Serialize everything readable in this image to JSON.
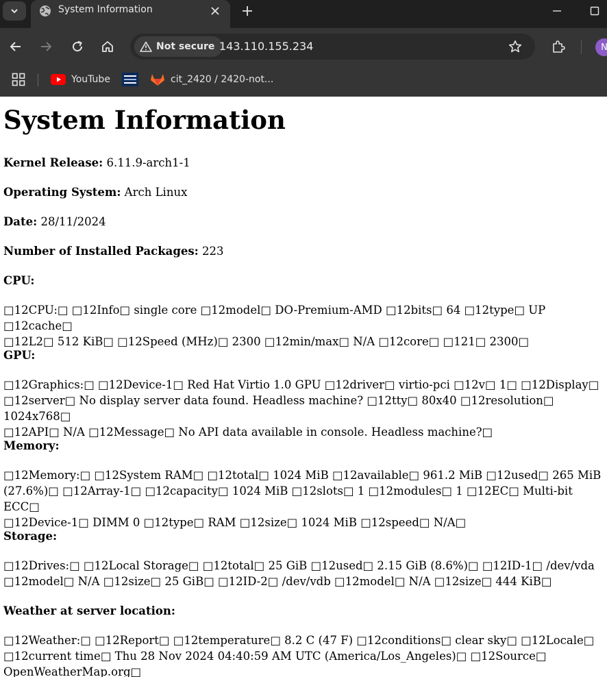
{
  "browser": {
    "tab_title": "System Information",
    "security_label": "Not secure",
    "url": "143.110.155.234",
    "avatar_letter": "N",
    "bookmarks": [
      {
        "label": "YouTube"
      },
      {
        "label": "cit_2420 / 2420-not..."
      }
    ]
  },
  "page": {
    "title": "System Information",
    "kernel": {
      "label": "Kernel Release:",
      "value": "6.11.9-arch1-1"
    },
    "os": {
      "label": "Operating System:",
      "value": "Arch Linux"
    },
    "date": {
      "label": "Date:",
      "value": "28/11/2024"
    },
    "packages": {
      "label": "Number of Installed Packages:",
      "value": "223"
    },
    "cpu": {
      "label": "CPU:",
      "text": "□12CPU:□ □12Info□ single core □12model□ DO-Premium-AMD □12bits□ 64 □12type□ UP □12cache□\n□12L2□ 512 KiB□ □12Speed (MHz)□ 2300 □12min/max□ N/A □12core□ □121□ 2300□"
    },
    "gpu": {
      "label": "GPU:",
      "text": "□12Graphics:□ □12Device-1□ Red Hat Virtio 1.0 GPU □12driver□ virtio-pci □12v□ 1□ □12Display□\n□12server□ No display server data found. Headless machine? □12tty□ 80x40 □12resolution□ 1024x768□\n□12API□ N/A □12Message□ No API data available in console. Headless machine?□"
    },
    "memory": {
      "label": "Memory:",
      "text": "□12Memory:□ □12System RAM□ □12total□ 1024 MiB □12available□ 961.2 MiB □12used□ 265 MiB\n(27.6%)□ □12Array-1□ □12capacity□ 1024 MiB □12slots□ 1 □12modules□ 1 □12EC□ Multi-bit ECC□\n□12Device-1□ DIMM 0 □12type□ RAM □12size□ 1024 MiB □12speed□ N/A□"
    },
    "storage": {
      "label": "Storage:",
      "text": "□12Drives:□ □12Local Storage□ □12total□ 25 GiB □12used□ 2.15 GiB (8.6%)□ □12ID-1□ /dev/vda\n□12model□ N/A □12size□ 25 GiB□ □12ID-2□ /dev/vdb □12model□ N/A □12size□ 444 KiB□"
    },
    "weather": {
      "label": "Weather at server location:",
      "text": "□12Weather:□ □12Report□ □12temperature□ 8.2 C (47 F) □12conditions□ clear sky□ □12Locale□\n□12current time□ Thu 28 Nov 2024 04:40:59 AM UTC (America/Los_Angeles)□ □12Source□\nOpenWeatherMap.org□"
    }
  }
}
